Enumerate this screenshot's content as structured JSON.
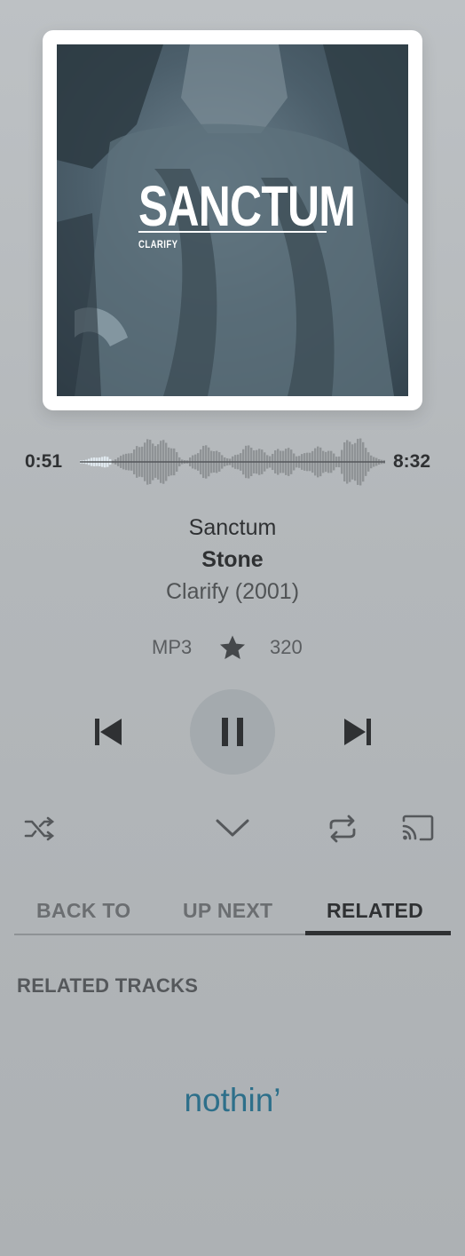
{
  "album_art": {
    "title": "SANCTUM",
    "artist_label": "CLARIFY"
  },
  "player": {
    "elapsed": "0:51",
    "total": "8:32",
    "progress": 0.1
  },
  "track": {
    "song": "Sanctum",
    "artist": "Stone",
    "album": "Clarify (2001)",
    "format": "MP3",
    "bitrate": "320"
  },
  "icons": {
    "favorite": "star-icon",
    "previous": "skip-previous-icon",
    "play_pause": "pause-icon",
    "next": "skip-next-icon",
    "shuffle": "shuffle-icon",
    "collapse": "chevron-down-icon",
    "repeat": "repeat-icon",
    "cast": "cast-icon"
  },
  "tabs": [
    {
      "label": "BACK TO",
      "active": false
    },
    {
      "label": "UP NEXT",
      "active": false
    },
    {
      "label": "RELATED",
      "active": true
    }
  ],
  "related": {
    "heading": "RELATED TRACKS",
    "empty_text": "nothin’"
  },
  "colors": {
    "accent": "#2d6f8a",
    "waveform_played": "#dfe8ee",
    "waveform_unplayed": "#8f9396"
  }
}
